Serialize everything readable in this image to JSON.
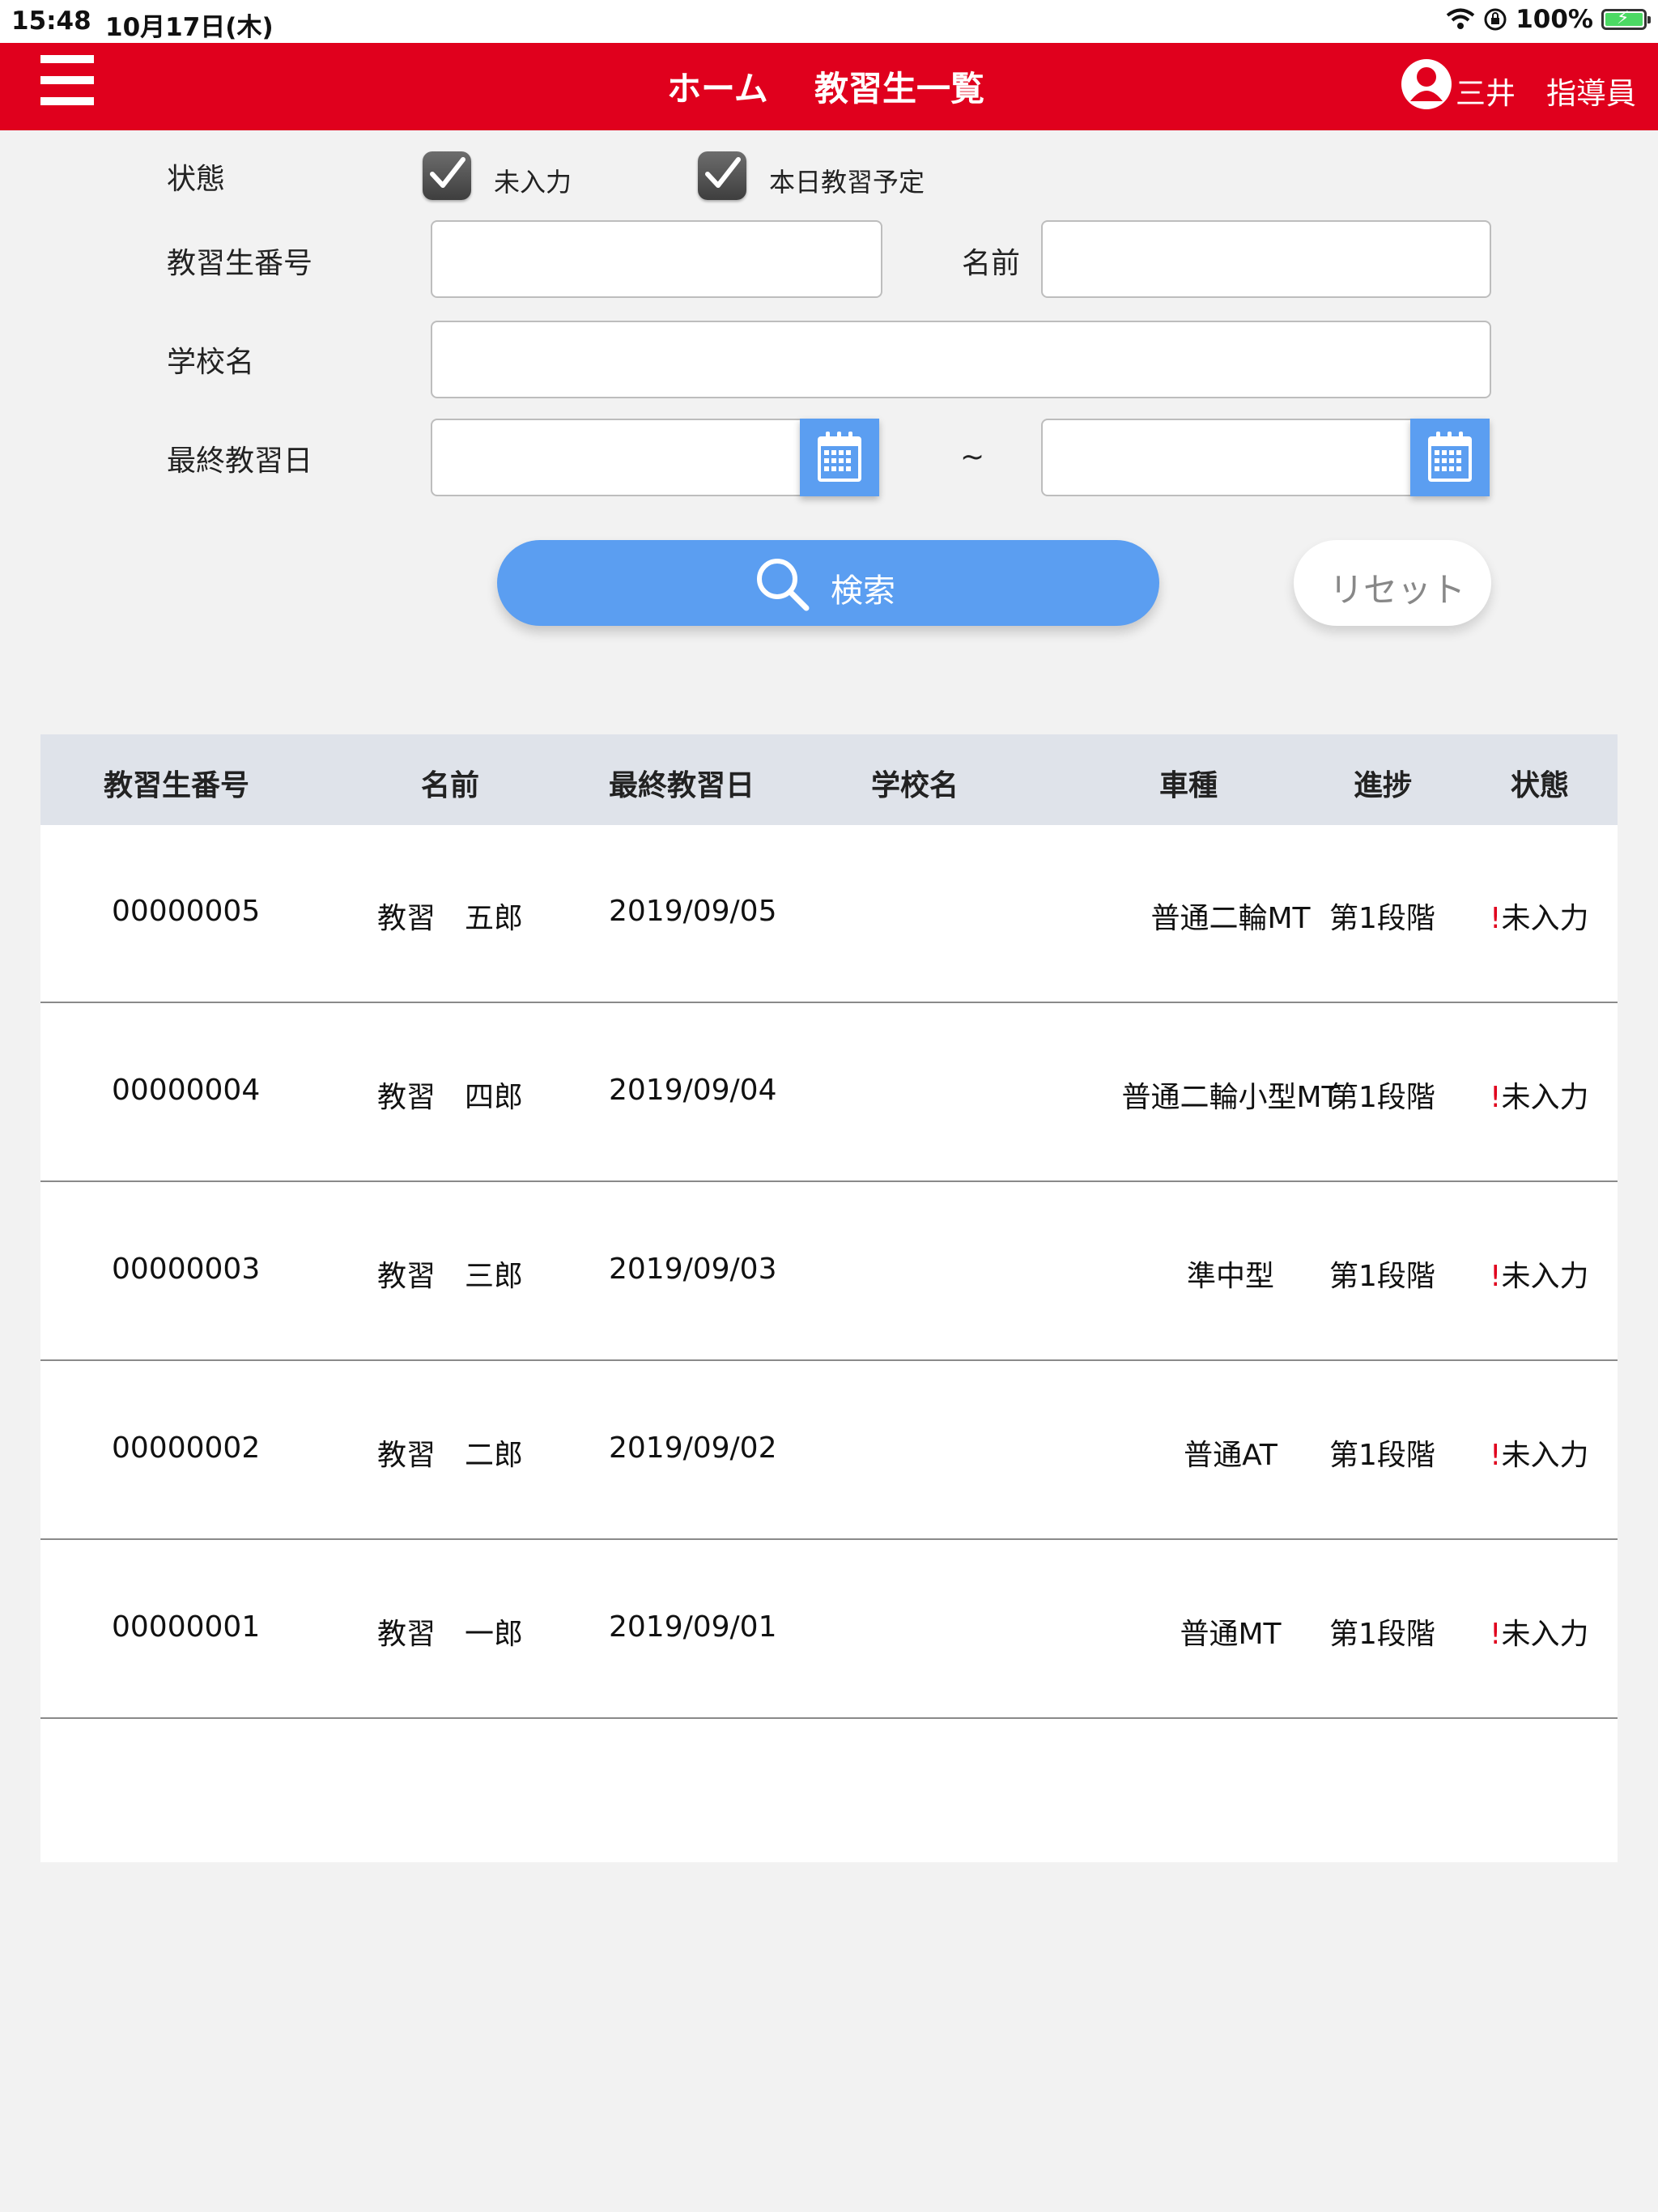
{
  "status_bar": {
    "time": "15:48",
    "date": "10月17日(木)",
    "battery": "100%"
  },
  "header": {
    "home": "ホーム",
    "title": "教習生一覧",
    "user_name": "三井",
    "user_role": "指導員"
  },
  "filters": {
    "state_label": "状態",
    "check_unentered": "未入力",
    "check_today": "本日教習予定",
    "student_no_label": "教習生番号",
    "name_label": "名前",
    "school_label": "学校名",
    "last_date_label": "最終教習日",
    "range_sep": "~",
    "student_no_value": "",
    "name_value": "",
    "school_value": "",
    "date_from_value": "",
    "date_to_value": ""
  },
  "buttons": {
    "search": "検索",
    "reset": "リセット"
  },
  "table": {
    "headers": [
      "教習生番号",
      "名前",
      "最終教習日",
      "学校名",
      "車種",
      "進捗",
      "状態"
    ],
    "rows": [
      {
        "no": "00000005",
        "name": "教習　五郎",
        "date": "2019/09/05",
        "school": "",
        "vehicle": "普通二輪MT",
        "progress": "第1段階",
        "mark": "!",
        "status": "未入力"
      },
      {
        "no": "00000004",
        "name": "教習　四郎",
        "date": "2019/09/04",
        "school": "",
        "vehicle": "普通二輪小型MT",
        "progress": "第1段階",
        "mark": "!",
        "status": "未入力"
      },
      {
        "no": "00000003",
        "name": "教習　三郎",
        "date": "2019/09/03",
        "school": "",
        "vehicle": "準中型",
        "progress": "第1段階",
        "mark": "!",
        "status": "未入力"
      },
      {
        "no": "00000002",
        "name": "教習　二郎",
        "date": "2019/09/02",
        "school": "",
        "vehicle": "普通AT",
        "progress": "第1段階",
        "mark": "!",
        "status": "未入力"
      },
      {
        "no": "00000001",
        "name": "教習　一郎",
        "date": "2019/09/01",
        "school": "",
        "vehicle": "普通MT",
        "progress": "第1段階",
        "mark": "!",
        "status": "未入力"
      }
    ]
  },
  "colors": {
    "brand_red": "#e0001d",
    "accent_blue": "#5b9ef1",
    "table_header": "#dfe3ea",
    "background": "#f2f2f2"
  }
}
